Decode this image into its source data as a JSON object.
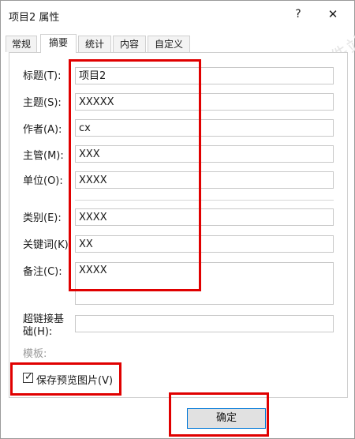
{
  "window": {
    "title": "项目2 属性",
    "help_label": "?",
    "close_label": "✕"
  },
  "tabs": [
    {
      "label": "常规"
    },
    {
      "label": "摘要",
      "active": true
    },
    {
      "label": "统计"
    },
    {
      "label": "内容"
    },
    {
      "label": "自定义"
    }
  ],
  "summary": {
    "title_label": "标题(T):",
    "title_value": "项目2",
    "subject_label": "主题(S):",
    "subject_value": "XXXXX",
    "author_label": "作者(A):",
    "author_value": "cx",
    "manager_label": "主管(M):",
    "manager_value": "XXX",
    "company_label": "单位(O):",
    "company_value": "XXXX",
    "category_label": "类别(E):",
    "category_value": "XXXX",
    "keywords_label": "关键词(K):",
    "keywords_value": "XX",
    "comments_label": "备注(C):",
    "comments_value": "XXXX",
    "hyperlink_label_line1": "超链接基",
    "hyperlink_label_line2": "础(H):",
    "hyperlink_value": "",
    "template_label": "模板:"
  },
  "save_preview": {
    "label": "保存预览图片(V)",
    "checked": true
  },
  "ok_button": {
    "label": "确定"
  },
  "highlight_color": "#e00000",
  "watermark": {
    "text": "www.ddooo.com  多多软件站"
  }
}
